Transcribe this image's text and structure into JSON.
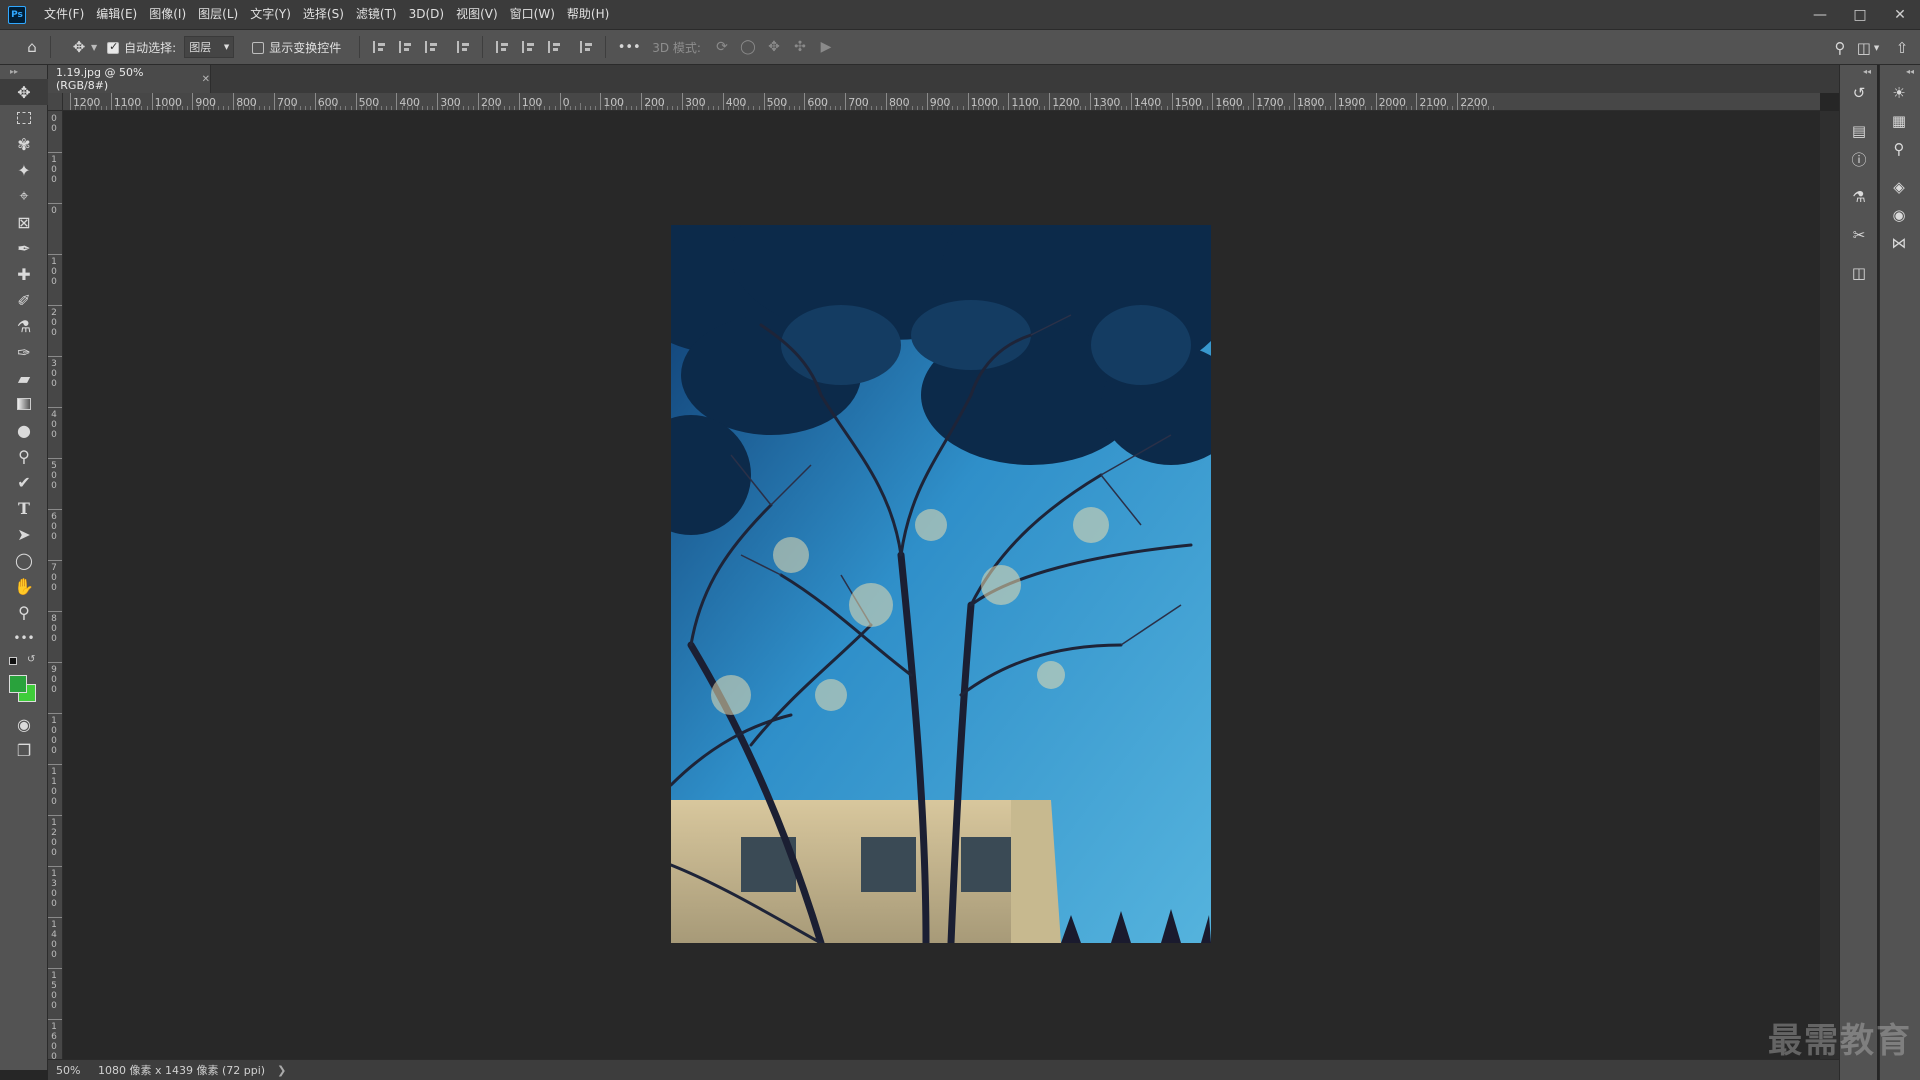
{
  "app": {
    "logo": "Ps",
    "menu": [
      "文件(F)",
      "编辑(E)",
      "图像(I)",
      "图层(L)",
      "文字(Y)",
      "选择(S)",
      "滤镜(T)",
      "3D(D)",
      "视图(V)",
      "窗口(W)",
      "帮助(H)"
    ],
    "window_controls": [
      "minimize-icon",
      "maximize-icon",
      "close-icon"
    ]
  },
  "options": {
    "auto_select_label": "自动选择:",
    "auto_select_checked": true,
    "layer_select_value": "图层",
    "show_transform_label": "显示变换控件",
    "show_transform_checked": false,
    "more": "•••",
    "mode3d_label": "3D 模式:"
  },
  "document": {
    "tab_title": "1.19.jpg @ 50%(RGB/8#)",
    "zoom": "50%",
    "info": "1080 像素 x 1439 像素 (72 ppi)"
  },
  "rulers": {
    "horizontal": [
      "1200",
      "1100",
      "1000",
      "900",
      "800",
      "700",
      "600",
      "500",
      "400",
      "300",
      "200",
      "100",
      "0",
      "100",
      "200",
      "300",
      "400",
      "500",
      "600",
      "700",
      "800",
      "900",
      "1000",
      "1100",
      "1200",
      "1300",
      "1400",
      "1500",
      "1600",
      "1700",
      "1800",
      "1900",
      "2000",
      "2100",
      "2200"
    ],
    "vertical": [
      "200",
      "100",
      "0",
      "100",
      "200",
      "300",
      "400",
      "500",
      "600",
      "700",
      "800",
      "900",
      "1000",
      "1100",
      "1200",
      "1300",
      "1400",
      "1500",
      "1600"
    ]
  },
  "colors": {
    "foreground": "#29a23c",
    "background": "#3fcd3a",
    "accent": "#31a8ff"
  },
  "watermark": "最需教育"
}
